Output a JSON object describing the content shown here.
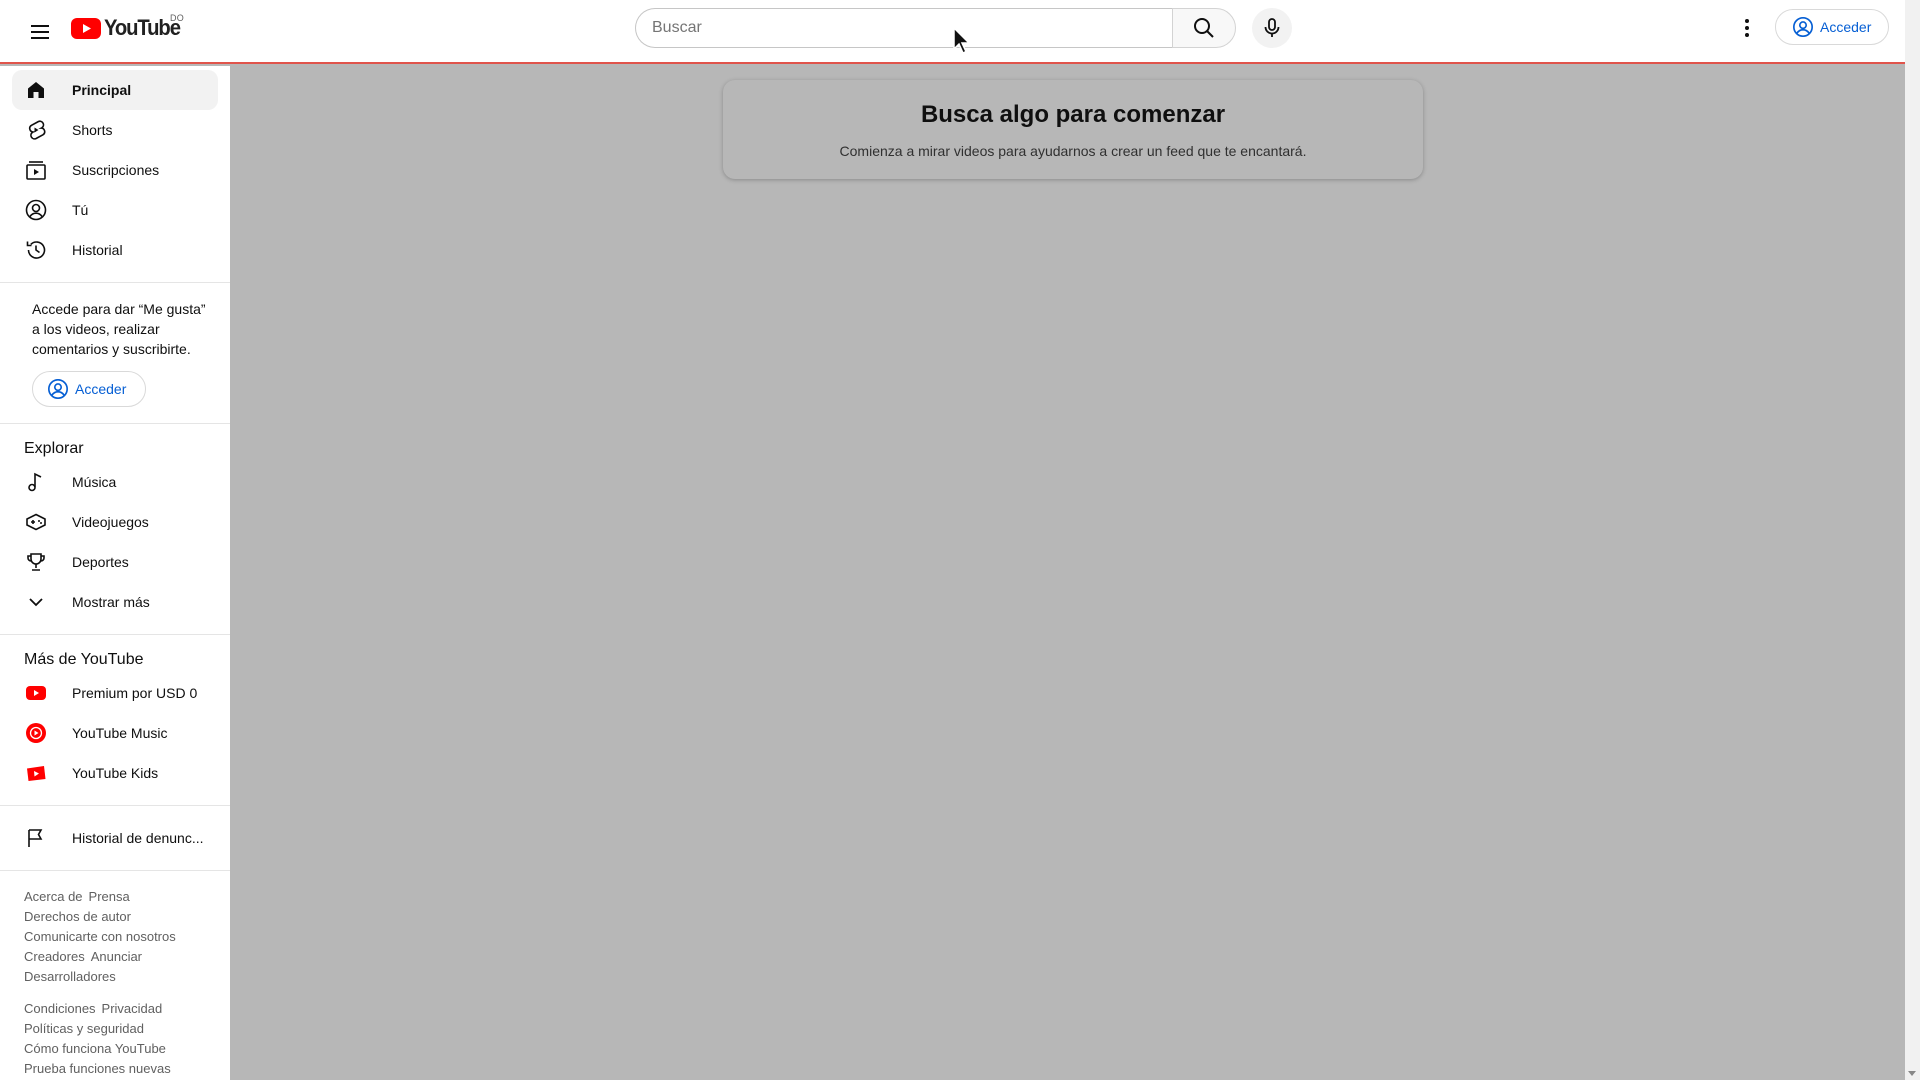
{
  "header": {
    "logo_text": "YouTube",
    "country_code": "DO",
    "search_placeholder": "Buscar",
    "signin_label": "Acceder"
  },
  "sidebar": {
    "primary": [
      {
        "label": "Principal",
        "icon": "home-icon",
        "active": true
      },
      {
        "label": "Shorts",
        "icon": "shorts-icon",
        "active": false
      },
      {
        "label": "Suscripciones",
        "icon": "subscriptions-icon",
        "active": false
      },
      {
        "label": "Tú",
        "icon": "account-icon",
        "active": false
      },
      {
        "label": "Historial",
        "icon": "history-icon",
        "active": false
      }
    ],
    "signin_prompt": "Accede para dar “Me gusta” a los videos, realizar comentarios y suscribirte.",
    "signin_label": "Acceder",
    "explore_title": "Explorar",
    "explore": [
      {
        "label": "Música",
        "icon": "music-icon"
      },
      {
        "label": "Videojuegos",
        "icon": "gaming-icon"
      },
      {
        "label": "Deportes",
        "icon": "trophy-icon"
      },
      {
        "label": "Mostrar más",
        "icon": "chevron-down-icon"
      }
    ],
    "more_title": "Más de YouTube",
    "more": [
      {
        "label": "Premium por USD 0",
        "icon": "youtube-premium-icon"
      },
      {
        "label": "YouTube Music",
        "icon": "youtube-music-icon"
      },
      {
        "label": "YouTube Kids",
        "icon": "youtube-kids-icon"
      }
    ],
    "report_history": {
      "label": "Historial de denunc...",
      "icon": "flag-icon"
    },
    "footer_block1": [
      "Acerca de",
      "Prensa",
      "Derechos de autor",
      "Comunicarte con nosotros",
      "Creadores",
      "Anunciar",
      "Desarrolladores"
    ],
    "footer_block2": [
      "Condiciones",
      "Privacidad",
      "Políticas y seguridad",
      "Cómo funciona YouTube",
      "Prueba funciones nuevas"
    ]
  },
  "main": {
    "empty_title": "Busca algo para comenzar",
    "empty_subtitle": "Comienza a mirar videos para ayudarnos a crear un feed que te encantará."
  },
  "colors": {
    "brand_red": "#ff0000",
    "link_blue": "#065fd4",
    "overlay_gray": "#b7b7b7"
  }
}
